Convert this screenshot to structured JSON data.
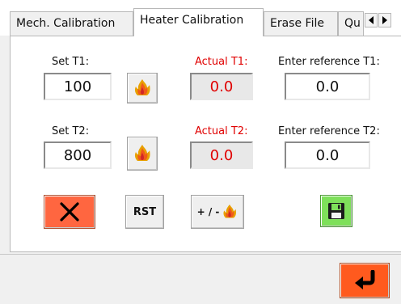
{
  "tabs": [
    {
      "label": "Mech. Calibration"
    },
    {
      "label": "Heater Calibration"
    },
    {
      "label": "Erase File"
    },
    {
      "label": "Qu"
    }
  ],
  "t1": {
    "set_label": "Set T1:",
    "set_value": "100",
    "actual_label": "Actual T1:",
    "actual_value": "0.0",
    "ref_label": "Enter reference T1:",
    "ref_value": "0.0"
  },
  "t2": {
    "set_label": "Set T2:",
    "set_value": "800",
    "actual_label": "Actual T2:",
    "actual_value": "0.0",
    "ref_label": "Enter reference T2:",
    "ref_value": "0.0"
  },
  "buttons": {
    "reset_label": "RST",
    "plusminus_label": "+ / -"
  },
  "icons": {
    "heat": "flame-icon",
    "cancel": "close-icon",
    "save": "floppy-disk-icon",
    "back": "return-arrow-icon"
  },
  "colors": {
    "actual_red": "#e00000",
    "cancel_button": "#ff6640",
    "save_button": "#7ee05a",
    "back_button": "#ff5a1e"
  }
}
